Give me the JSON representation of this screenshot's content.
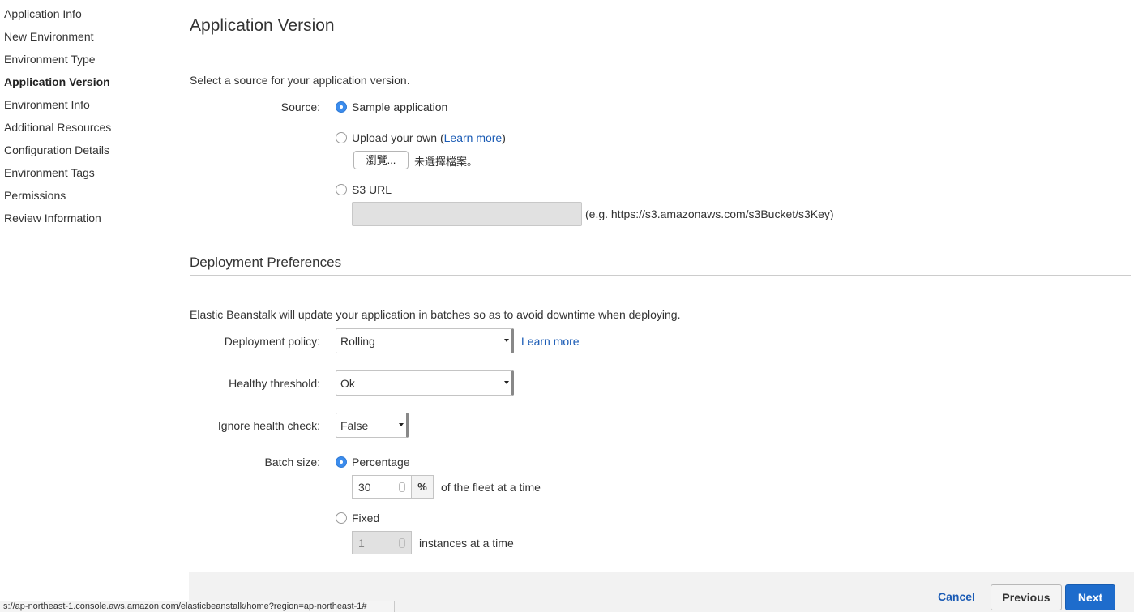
{
  "sidebar": {
    "items": [
      {
        "label": "Application Info",
        "active": false
      },
      {
        "label": "New Environment",
        "active": false
      },
      {
        "label": "Environment Type",
        "active": false
      },
      {
        "label": "Application Version",
        "active": true
      },
      {
        "label": "Environment Info",
        "active": false
      },
      {
        "label": "Additional Resources",
        "active": false
      },
      {
        "label": "Configuration Details",
        "active": false
      },
      {
        "label": "Environment Tags",
        "active": false
      },
      {
        "label": "Permissions",
        "active": false
      },
      {
        "label": "Review Information",
        "active": false
      }
    ]
  },
  "app_version": {
    "heading": "Application Version",
    "intro": "Select a source for your application version.",
    "source_label": "Source:",
    "options": {
      "sample": {
        "label": "Sample application",
        "selected": true
      },
      "upload": {
        "label_prefix": "Upload your own (",
        "link": "Learn more",
        "label_suffix": ")",
        "selected": false
      },
      "s3": {
        "label": "S3 URL",
        "selected": false
      }
    },
    "file_button": "瀏覽...",
    "file_status": "未選擇檔案。",
    "s3_url_value": "",
    "s3_hint": "(e.g. https://s3.amazonaws.com/s3Bucket/s3Key)"
  },
  "deployment": {
    "heading": "Deployment Preferences",
    "intro": "Elastic Beanstalk will update your application in batches so as to avoid downtime when deploying.",
    "policy_label": "Deployment policy:",
    "policy_value": "Rolling",
    "policy_link": "Learn more",
    "threshold_label": "Healthy threshold:",
    "threshold_value": "Ok",
    "ignore_label": "Ignore health check:",
    "ignore_value": "False",
    "batch_label": "Batch size:",
    "percentage": {
      "label": "Percentage",
      "selected": true,
      "value": "30",
      "unit": "%",
      "suffix": "of the fleet at a time"
    },
    "fixed": {
      "label": "Fixed",
      "selected": false,
      "value": "1",
      "suffix": "instances at a time"
    }
  },
  "footer": {
    "cancel": "Cancel",
    "previous": "Previous",
    "next": "Next"
  },
  "statusbar": {
    "url": "s://ap-northeast-1.console.aws.amazon.com/elasticbeanstalk/home?region=ap-northeast-1#"
  },
  "colors": {
    "primary": "#1e6ccc",
    "link": "#1a5bb5",
    "radio_selected": "#3b8ced"
  }
}
